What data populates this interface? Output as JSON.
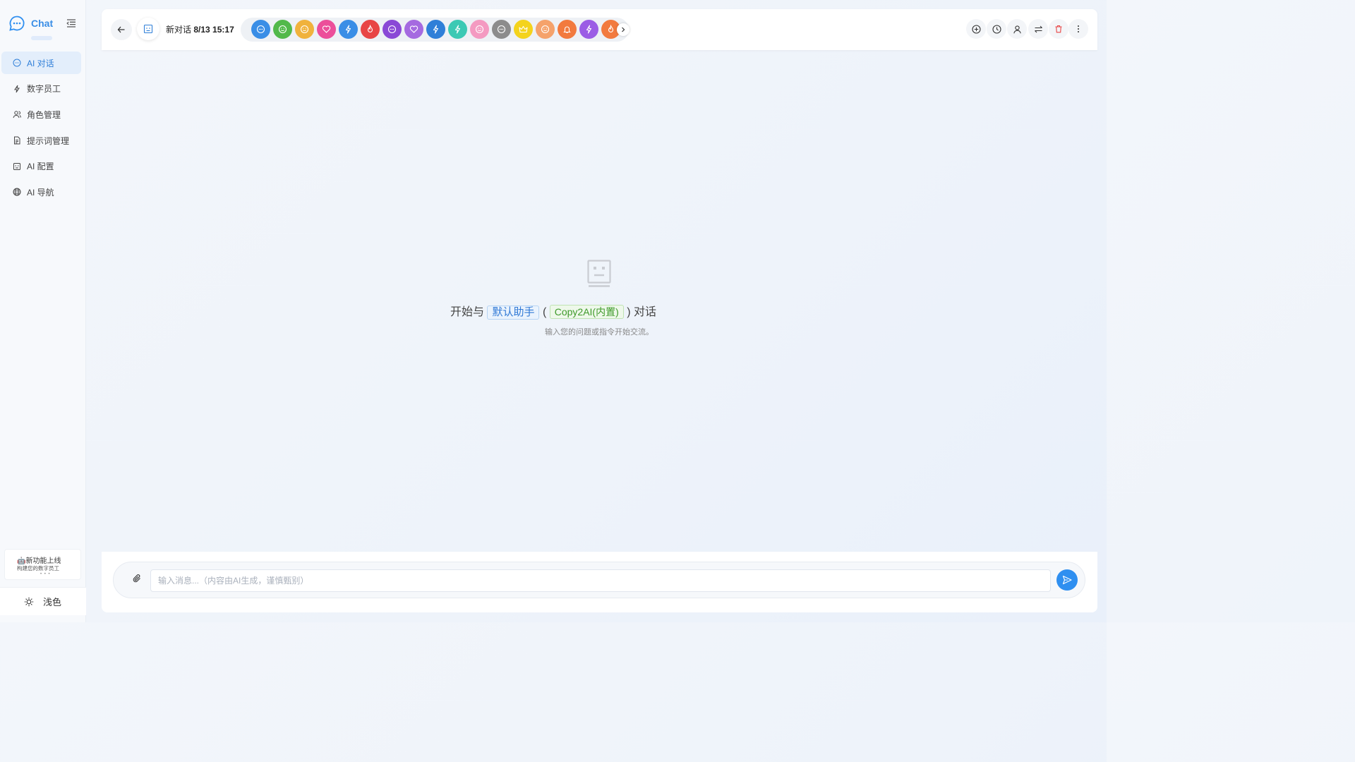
{
  "sidebar": {
    "app_name": "Chat",
    "items": [
      {
        "label": "AI 对话",
        "icon": "chat-icon",
        "active": true
      },
      {
        "label": "数字员工",
        "icon": "bolt-icon",
        "active": false
      },
      {
        "label": "角色管理",
        "icon": "users-icon",
        "active": false
      },
      {
        "label": "提示词管理",
        "icon": "document-icon",
        "active": false
      },
      {
        "label": "AI 配置",
        "icon": "robot-icon",
        "active": false
      },
      {
        "label": "AI 导航",
        "icon": "globe-icon",
        "active": false
      }
    ],
    "promo": {
      "title": "🤖新功能上线",
      "subtitle": "构建您的数字员工",
      "dots": "• • •"
    },
    "theme_label": "浅色"
  },
  "header": {
    "conversation_prefix": "新对话",
    "conversation_time": "8/13 15:17",
    "roles": [
      {
        "color": "#3a8ee6",
        "icon": "chat-icon"
      },
      {
        "color": "#52b94a",
        "icon": "smile-icon"
      },
      {
        "color": "#f0b23c",
        "icon": "smile-icon"
      },
      {
        "color": "#ec4f9a",
        "icon": "heart-icon"
      },
      {
        "color": "#3a8ee6",
        "icon": "bolt-icon"
      },
      {
        "color": "#e84545",
        "icon": "flame-icon"
      },
      {
        "color": "#8a49d6",
        "icon": "chat-icon"
      },
      {
        "color": "#a56ae0",
        "icon": "heart-icon"
      },
      {
        "color": "#2f7fd8",
        "icon": "bolt-icon"
      },
      {
        "color": "#3cc9b4",
        "icon": "bolt-icon"
      },
      {
        "color": "#f49ac1",
        "icon": "smile-icon"
      },
      {
        "color": "#8c8c8c",
        "icon": "chat-icon"
      },
      {
        "color": "#f4d31c",
        "icon": "crown-icon"
      },
      {
        "color": "#f5a26b",
        "icon": "smile-icon"
      },
      {
        "color": "#f27a3e",
        "icon": "bell-icon"
      },
      {
        "color": "#9b5de5",
        "icon": "bolt-icon"
      },
      {
        "color": "#f27a3e",
        "icon": "flame-icon"
      }
    ],
    "tools": [
      "add-circle-icon",
      "history-icon",
      "user-icon",
      "swap-icon",
      "trash-icon",
      "more-vertical-icon"
    ]
  },
  "empty_state": {
    "prefix": "开始与",
    "assistant": "默认助手",
    "open_paren": "(",
    "model": "Copy2AI(内置)",
    "close_paren": ")",
    "suffix": "对话",
    "hint": "输入您的问题或指令开始交流。"
  },
  "composer": {
    "placeholder": "输入消息...（内容由AI生成，谨慎甄别）",
    "value": ""
  },
  "colors": {
    "accent": "#2f8ff0",
    "active_bg": "#e3eefb",
    "danger": "#e84545"
  }
}
